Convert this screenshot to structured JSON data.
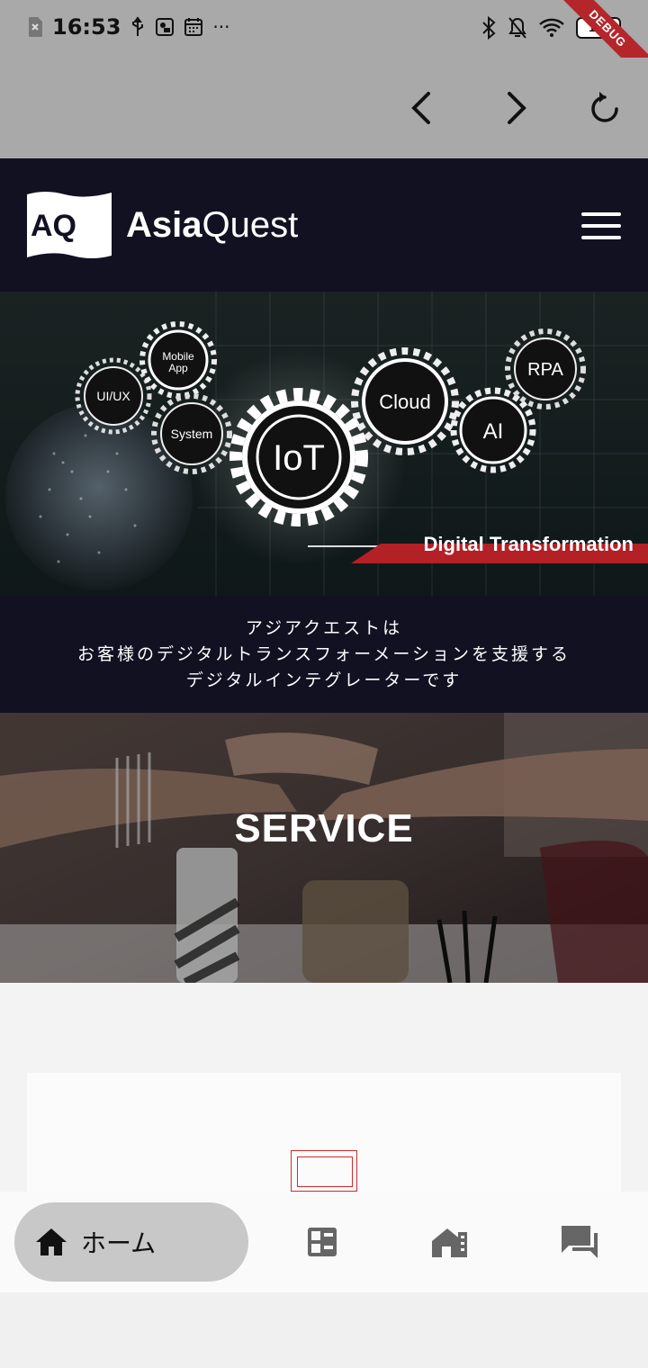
{
  "status_bar": {
    "time": "16:53",
    "battery": "100",
    "debug_banner": "DEBUG",
    "more_dots": "···"
  },
  "browser_nav": {
    "back_icon": "chevron-left-icon",
    "forward_icon": "chevron-right-icon",
    "reload_icon": "reload-icon"
  },
  "header": {
    "logo_mark": "AQ",
    "logo_asia": "Asia",
    "logo_quest": "Quest",
    "menu_icon": "hamburger-icon"
  },
  "hero": {
    "gears": [
      "Mobile App",
      "UI/UX",
      "System",
      "IoT",
      "Cloud",
      "AI",
      "RPA"
    ],
    "banner": "Digital Transformation"
  },
  "tagline": {
    "line1": "アジアクエストは",
    "line2": "お客様のデジタルトランスフォーメーションを支援する",
    "line3": "デジタルインテグレーターです"
  },
  "service": {
    "title": "SERVICE"
  },
  "bottom_nav": {
    "home_label": "ホーム",
    "items": [
      "home-icon",
      "services-grid-icon",
      "company-building-icon",
      "contact-chat-icon"
    ]
  }
}
